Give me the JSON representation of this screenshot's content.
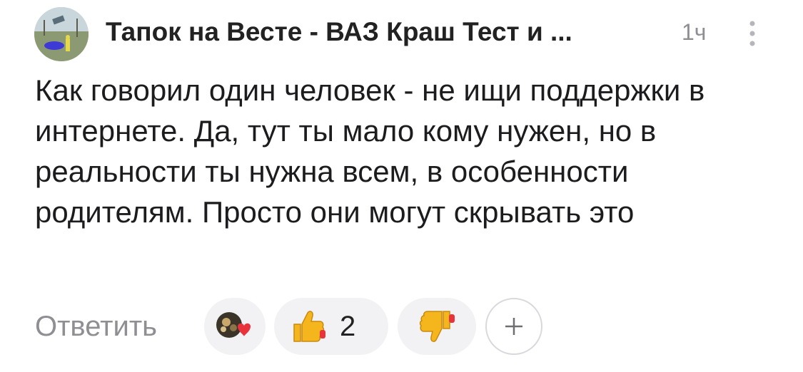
{
  "comment": {
    "author": "Тапок на Весте - ВАЗ Краш Тест и ...",
    "time": "1ч",
    "text": "Как говорил один человек - не ищи поддержки в интернете. Да, тут ты мало кому нужен, но в реальности ты нужна всем, в особенности родителям. Просто они могут скрывать это"
  },
  "actions": {
    "reply_label": "Ответить",
    "like_count": "2",
    "add_reaction_icon": "plus-icon"
  },
  "icons": {
    "more": "vertical-dots-icon",
    "like": "thumbs-up-icon",
    "dislike": "thumbs-down-icon",
    "reaction": "heart-icon"
  },
  "colors": {
    "text": "#1c1c1e",
    "muted": "#8e8e93",
    "pill_bg": "#f2f2f5",
    "emoji_yellow": "#f5b51d",
    "heart_red": "#e8323c"
  }
}
